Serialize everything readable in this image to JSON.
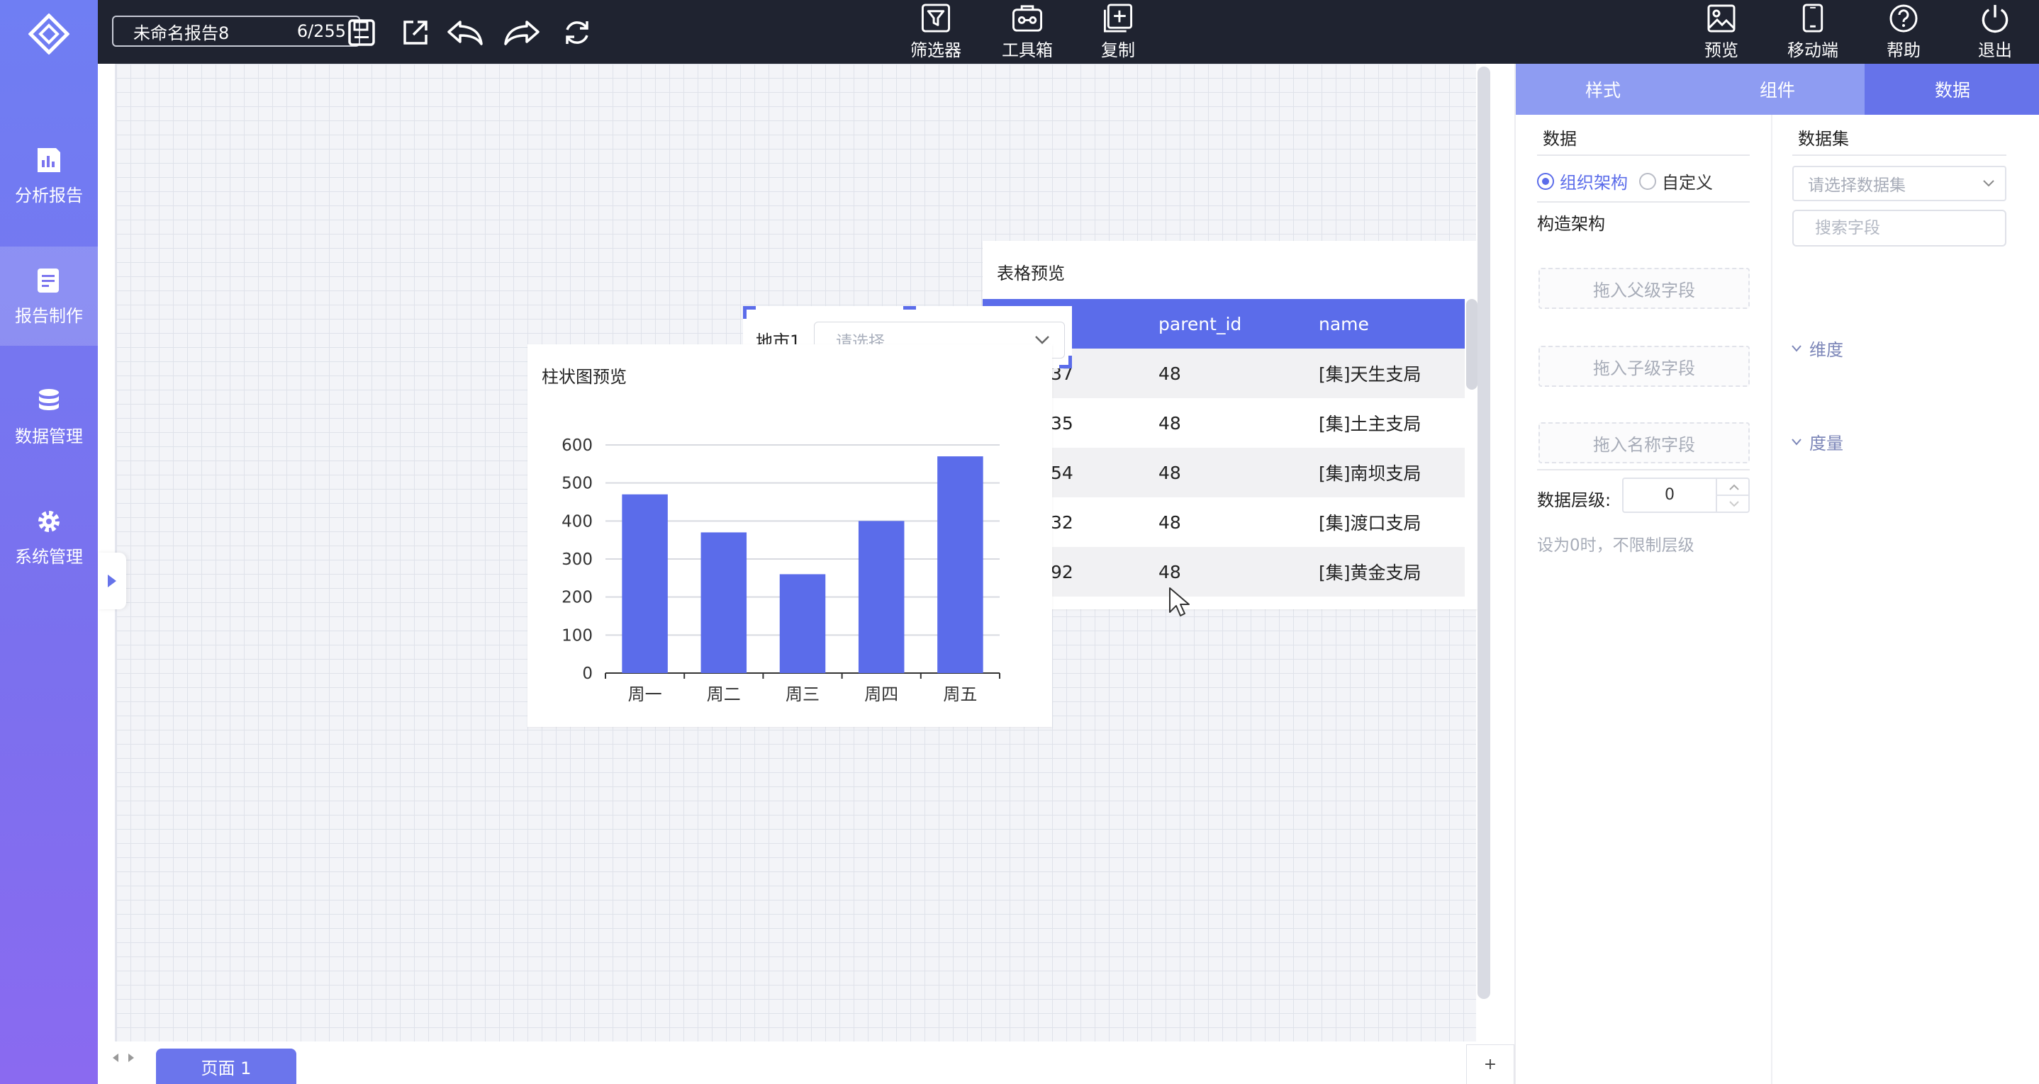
{
  "sidebar": {
    "items": [
      {
        "label": "分析报告",
        "icon": "report-chart-icon"
      },
      {
        "label": "报告制作",
        "icon": "report-edit-icon"
      },
      {
        "label": "数据管理",
        "icon": "database-icon"
      },
      {
        "label": "系统管理",
        "icon": "gear-icon"
      }
    ],
    "active_index": 1
  },
  "topbar": {
    "report_name": "未命名报告8",
    "char_count": "6/255",
    "center_tools": [
      {
        "label": "筛选器",
        "icon": "filter-icon"
      },
      {
        "label": "工具箱",
        "icon": "toolbox-icon"
      },
      {
        "label": "复制",
        "icon": "copy-plus-icon"
      }
    ],
    "right_tools": [
      {
        "label": "预览",
        "icon": "preview-image-icon"
      },
      {
        "label": "移动端",
        "icon": "mobile-icon"
      },
      {
        "label": "帮助",
        "icon": "help-icon"
      },
      {
        "label": "退出",
        "icon": "power-icon"
      }
    ]
  },
  "table_widget": {
    "title": "表格预览",
    "columns": [
      "",
      "parent_id",
      "name"
    ],
    "rows": [
      [
        "37",
        "48",
        "[集]天生支局"
      ],
      [
        "35",
        "48",
        "[集]土主支局"
      ],
      [
        "54",
        "48",
        "[集]南坝支局"
      ],
      [
        "32",
        "48",
        "[集]渡口支局"
      ],
      [
        "92",
        "48",
        "[集]黄金支局"
      ]
    ]
  },
  "filter_widget": {
    "label": "地市1",
    "placeholder": "请选择"
  },
  "bar_widget": {
    "title": "柱状图预览"
  },
  "chart_data": {
    "type": "bar",
    "categories": [
      "周一",
      "周二",
      "周三",
      "周四",
      "周五"
    ],
    "values": [
      470,
      370,
      260,
      400,
      570
    ],
    "yticks": [
      0,
      100,
      200,
      300,
      400,
      500,
      600
    ],
    "ylim": [
      0,
      600
    ],
    "grid": true,
    "color": "#5b6cea"
  },
  "pagebar": {
    "page_tab": "页面 1",
    "add_label": "+"
  },
  "right_panel": {
    "tabs": [
      "样式",
      "组件",
      "数据"
    ],
    "active_tab": 2,
    "data_heading": "数据",
    "mode_options": [
      "组织架构",
      "自定义"
    ],
    "selected_mode": 0,
    "build_heading": "构造架构",
    "drop_parent": "拖入父级字段",
    "drop_child": "拖入子级字段",
    "drop_name": "拖入名称字段",
    "level_label": "数据层级:",
    "level_value": "0",
    "level_hint": "设为0时，不限制层级",
    "dataset_heading": "数据集",
    "dataset_placeholder": "请选择数据集",
    "search_placeholder": "搜索字段",
    "dimension_label": "维度",
    "measure_label": "度量"
  }
}
